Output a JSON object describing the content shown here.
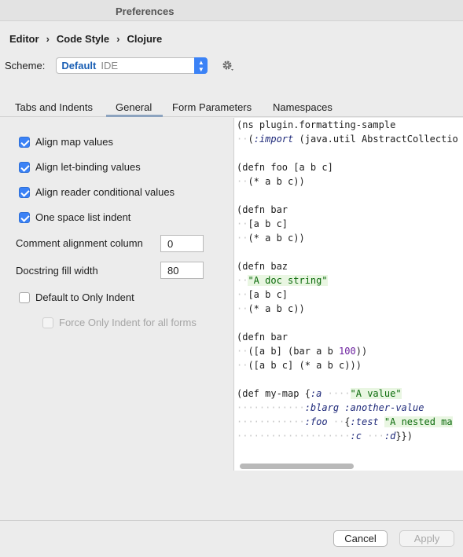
{
  "window": {
    "title": "Preferences"
  },
  "breadcrumb": [
    "Editor",
    "Code Style",
    "Clojure"
  ],
  "scheme": {
    "label": "Scheme:",
    "name": "Default",
    "kind": "IDE"
  },
  "tabs": [
    "Tabs and Indents",
    "General",
    "Form Parameters",
    "Namespaces"
  ],
  "active_tab": "General",
  "options": {
    "align_map": {
      "label": "Align map values",
      "checked": true
    },
    "align_let": {
      "label": "Align let-binding values",
      "checked": true
    },
    "align_reader": {
      "label": "Align reader conditional values",
      "checked": true
    },
    "one_space": {
      "label": "One space list indent",
      "checked": true
    },
    "comment_col": {
      "label": "Comment alignment column",
      "value": "0"
    },
    "docstring": {
      "label": "Docstring fill width",
      "value": "80"
    },
    "default_only": {
      "label": "Default to Only Indent",
      "checked": false
    },
    "force_only": {
      "label": "Force Only Indent for all forms",
      "checked": false,
      "disabled": true
    }
  },
  "code_lines": [
    "(ns plugin.formatting-sample",
    "··(:import (java.util AbstractCollectio",
    "",
    "(defn foo [a b c]",
    "··(* a b c))",
    "",
    "(defn bar",
    "··[a b c]",
    "··(* a b c))",
    "",
    "(defn baz",
    "··\"A doc string\"",
    "··[a b c]",
    "··(* a b c))",
    "",
    "(defn bar",
    "··([a b] (bar a b 100))",
    "··([a b c] (* a b c)))",
    "",
    "(def my-map {:a ····\"A value\"",
    "············:blarg :another-value",
    "············:foo ··{:test \"A nested ma",
    "····················:c ···:d}})"
  ],
  "buttons": {
    "cancel": "Cancel",
    "apply": "Apply"
  }
}
